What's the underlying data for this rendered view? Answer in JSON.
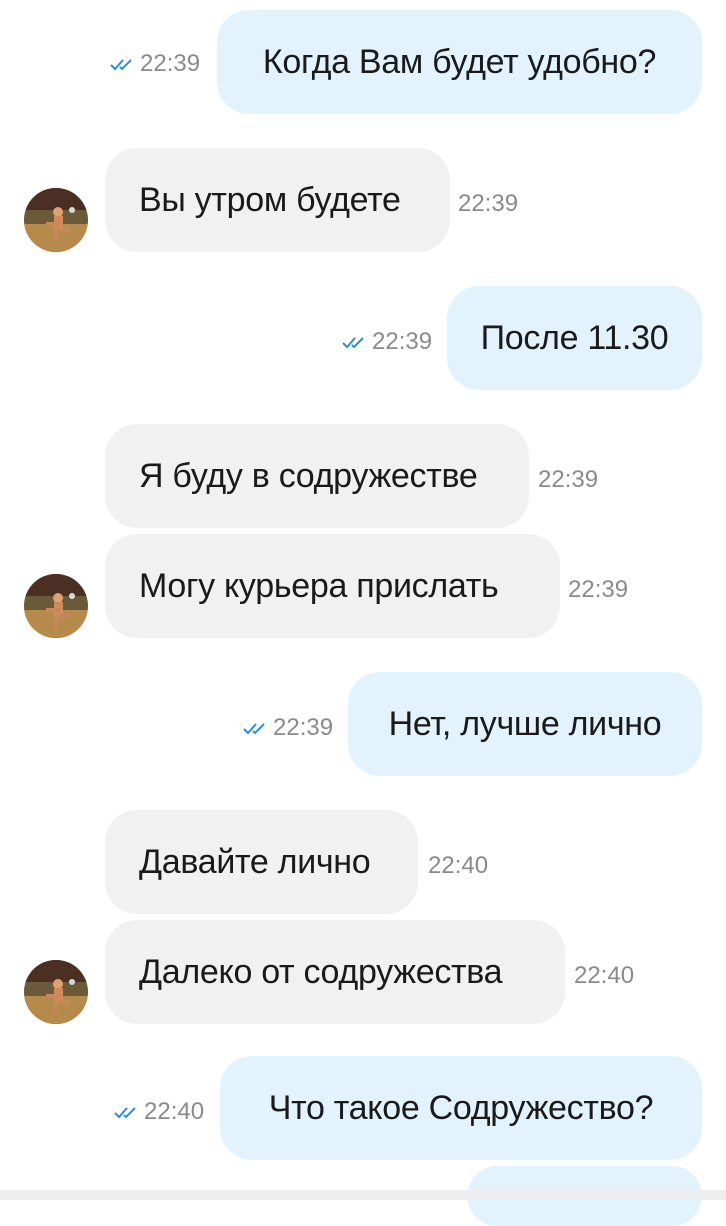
{
  "messages": [
    {
      "dir": "out",
      "text": "Когда Вам будет удобно?",
      "time": "22:39"
    },
    {
      "dir": "in",
      "text": "Вы утром будете",
      "time": "22:39"
    },
    {
      "dir": "out",
      "text": "После 11.30",
      "time": "22:39"
    },
    {
      "dir": "in",
      "text": "Я буду в содружестве",
      "time": "22:39"
    },
    {
      "dir": "in",
      "text": "Могу курьера прислать",
      "time": "22:39"
    },
    {
      "dir": "out",
      "text": "Нет, лучше лично",
      "time": "22:39"
    },
    {
      "dir": "in",
      "text": "Давайте лично",
      "time": "22:40"
    },
    {
      "dir": "in",
      "text": "Далеко от содружества",
      "time": "22:40"
    },
    {
      "dir": "out",
      "text": "Что такое Содружество?",
      "time": "22:40"
    }
  ],
  "colors": {
    "outgoing_bubble": "#e3f3fd",
    "incoming_bubble": "#f1f1f1",
    "read_check": "#2a8fd8",
    "timestamp": "#8a8a8a"
  },
  "icons": {
    "read_receipt": "double-check-icon",
    "sender_avatar": "avatar"
  }
}
